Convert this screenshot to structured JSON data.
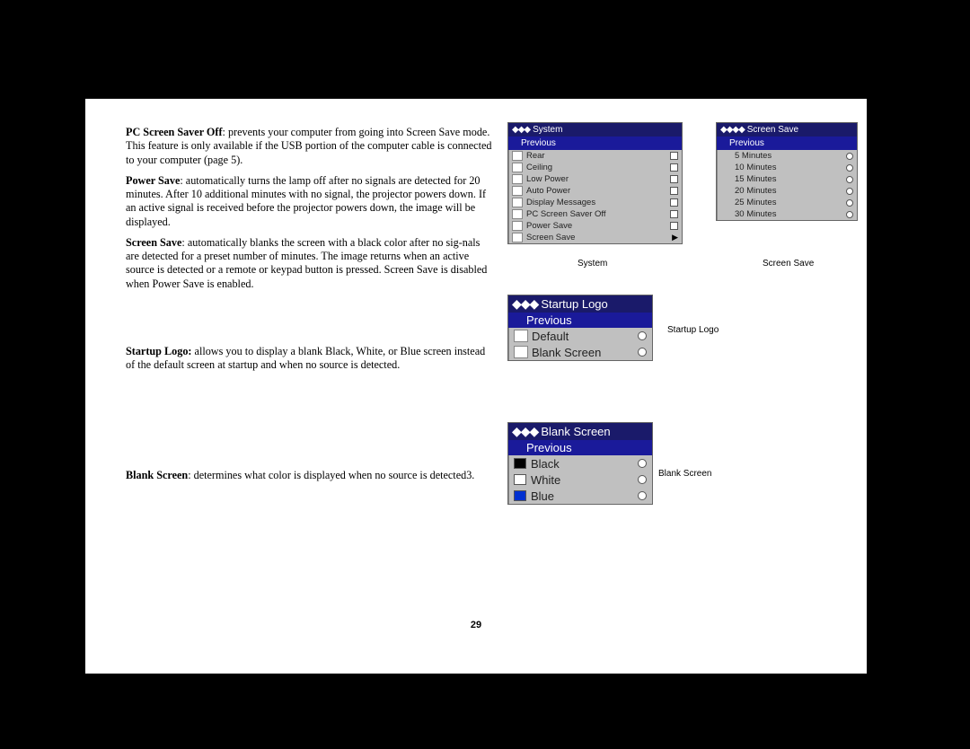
{
  "paragraphs": {
    "p1_bold": "PC Screen Saver Off",
    "p1_rest": ": prevents your computer from going into Screen Save mode. This feature is only available if the USB portion of the computer cable is connected to your computer (page 5).",
    "p2_bold": "Power Save",
    "p2_rest": ": automatically turns the lamp off after no signals are detected for 20 minutes. After 10 additional minutes with no signal, the projector powers down. If an active signal is received before the projector powers down, the image will be displayed.",
    "p3_bold": "Screen Save",
    "p3_rest": ": automatically blanks the screen with a black color after no sig-nals are detected for a preset number of minutes. The image returns when an active source is detected or a remote or keypad button is pressed. Screen Save is disabled when Power Save is enabled.",
    "p4_bold": "Startup Logo:",
    "p4_rest": " allows you to display a blank Black, White, or Blue screen instead of the default screen at startup and when no source is detected.",
    "p5_bold": "Blank Screen",
    "p5_rest": ": determines what color is displayed when no source is detected3."
  },
  "menus": {
    "system": {
      "title": "System",
      "prev": "Previous",
      "items": [
        {
          "label": "Rear",
          "ctrl": "check"
        },
        {
          "label": "Ceiling",
          "ctrl": "check"
        },
        {
          "label": "Low Power",
          "ctrl": "check"
        },
        {
          "label": "Auto Power",
          "ctrl": "check"
        },
        {
          "label": "Display Messages",
          "ctrl": "check"
        },
        {
          "label": "PC Screen Saver Off",
          "ctrl": "check"
        },
        {
          "label": "Power Save",
          "ctrl": "check"
        },
        {
          "label": "Screen Save",
          "ctrl": "arrow"
        }
      ],
      "caption": "System"
    },
    "screensave": {
      "title": "Screen Save",
      "prev": "Previous",
      "items": [
        {
          "label": "5 Minutes"
        },
        {
          "label": "10 Minutes"
        },
        {
          "label": "15 Minutes"
        },
        {
          "label": "20 Minutes"
        },
        {
          "label": "25 Minutes"
        },
        {
          "label": "30 Minutes"
        }
      ],
      "caption": "Screen Save"
    },
    "startup": {
      "title": "Startup Logo",
      "prev": "Previous",
      "items": [
        {
          "label": "Default"
        },
        {
          "label": "Blank Screen"
        }
      ],
      "caption": "Startup Logo"
    },
    "blank": {
      "title": "Blank Screen",
      "prev": "Previous",
      "items": [
        {
          "label": "Black",
          "color": "#000"
        },
        {
          "label": "White",
          "color": "#fff"
        },
        {
          "label": "Blue",
          "color": "#0030d0"
        }
      ],
      "caption": "Blank Screen"
    }
  },
  "page_number": "29"
}
